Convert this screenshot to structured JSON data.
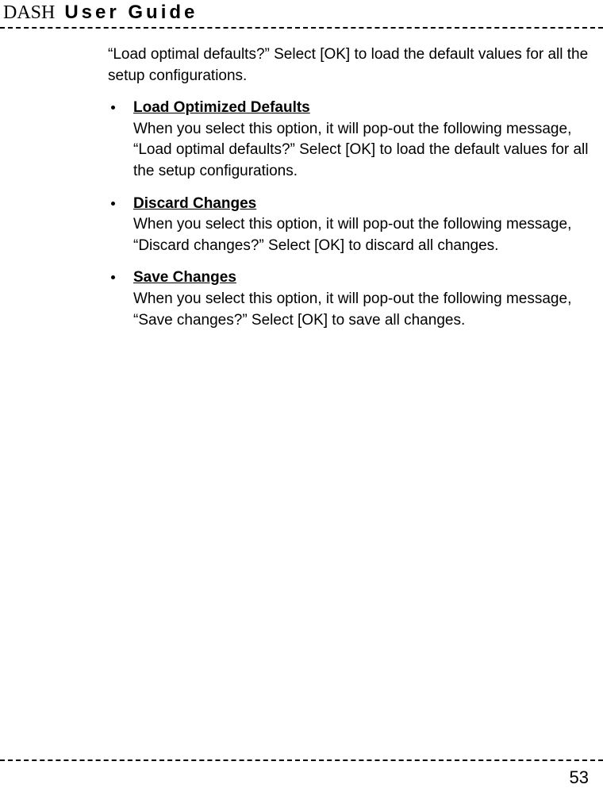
{
  "header": {
    "brand": "DASH",
    "title": "User Guide"
  },
  "intro": "“Load optimal defaults?” Select [OK] to load the default values for all the setup configurations.",
  "items": [
    {
      "title": "Load Optimized Defaults",
      "text": "When you select this option, it will pop-out the following message, “Load optimal defaults?” Select [OK] to load the default values for all the setup configurations."
    },
    {
      "title": "Discard Changes",
      "text": "When you select this option, it will pop-out the following message, “Discard changes?” Select [OK] to discard all changes."
    },
    {
      "title": "Save Changes",
      "text": "When you select this option, it will pop-out the following message, “Save changes?” Select [OK] to save all changes."
    }
  ],
  "pageNumber": "53"
}
